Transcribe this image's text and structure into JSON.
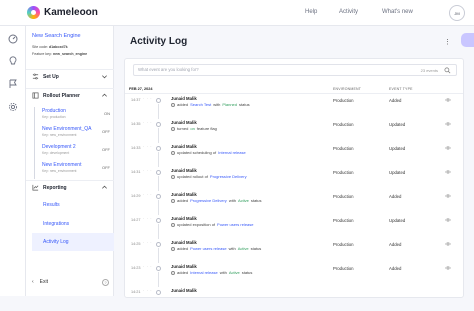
{
  "app": {
    "brand": "Kameleoon",
    "nav": [
      "Help",
      "Activity",
      "What's new"
    ],
    "avatar": "JM"
  },
  "sidebar": {
    "project_title": "New Search Engine",
    "site_code_label": "Site code:",
    "site_code": "d1abcxd7k",
    "feature_key_label": "Feature key:",
    "feature_key": "new_search_engine",
    "setup_label": "Set Up",
    "rollout_label": "Rollout Planner",
    "environments": [
      {
        "name": "Production",
        "key": "Key: production",
        "state": "ON"
      },
      {
        "name": "New Environment_QA",
        "key": "Key: new_environment",
        "state": "OFF"
      },
      {
        "name": "Development 2",
        "key": "Key: development",
        "state": "OFF"
      },
      {
        "name": "New Environment",
        "key": "Key: new_environment",
        "state": "OFF"
      }
    ],
    "reporting_label": "Reporting",
    "sub_items": [
      "Results",
      "Integrations",
      "Activity Log"
    ],
    "exit_label": "Exit",
    "help_glyph": "?"
  },
  "main": {
    "title": "Activity Log",
    "search_placeholder": "What event are you looking for?",
    "search_count": "23 events",
    "columns": {
      "environment": "Environment",
      "event_type": "Event type"
    },
    "date_header": "FEB 27, 2024",
    "rows": [
      {
        "time": "14:37",
        "who": "Junaid Malik",
        "pre": "added",
        "link": "Search Test",
        "mid": "with",
        "status": "Planned",
        "post": "status",
        "env": "Production",
        "type": "Added"
      },
      {
        "time": "14:35",
        "who": "Junaid Malik",
        "pre": "turned",
        "link": "",
        "mid": "",
        "status": "on",
        "post": "feature flag",
        "env": "Production",
        "type": "Updated"
      },
      {
        "time": "14:33",
        "who": "Junaid Malik",
        "pre": "updated scheduling of",
        "link": "Internal release",
        "mid": "",
        "status": "",
        "post": "",
        "env": "Production",
        "type": "Updated"
      },
      {
        "time": "14:31",
        "who": "Junaid Malik",
        "pre": "updated rollout of",
        "link": "Progressive Delivery",
        "mid": "",
        "status": "",
        "post": "",
        "env": "Production",
        "type": "Updated"
      },
      {
        "time": "14:29",
        "who": "Junaid Malik",
        "pre": "added",
        "link": "Progressive Delivery",
        "mid": "with",
        "status": "Active",
        "post": "status",
        "env": "Production",
        "type": "Added"
      },
      {
        "time": "14:27",
        "who": "Junaid Malik",
        "pre": "updated exposition of",
        "link": "Power users release",
        "mid": "",
        "status": "",
        "post": "",
        "env": "Production",
        "type": "Updated"
      },
      {
        "time": "14:25",
        "who": "Junaid Malik",
        "pre": "added",
        "link": "Power users release",
        "mid": "with",
        "status": "Active",
        "post": "status",
        "env": "Production",
        "type": "Added"
      },
      {
        "time": "14:23",
        "who": "Junaid Malik",
        "pre": "added",
        "link": "Internal release",
        "mid": "with",
        "status": "Active",
        "post": "status",
        "env": "Production",
        "type": "Added"
      },
      {
        "time": "14:21",
        "who": "Junaid Malik",
        "pre": "",
        "link": "",
        "mid": "",
        "status": "",
        "post": "",
        "env": "",
        "type": ""
      }
    ]
  }
}
